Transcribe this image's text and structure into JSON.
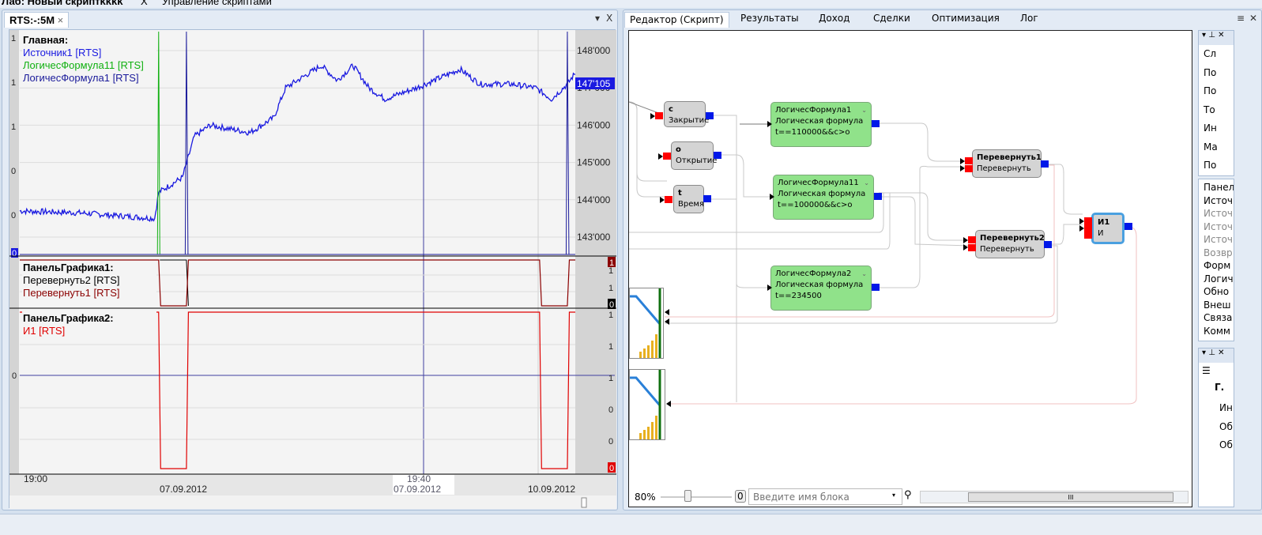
{
  "top_tabs": [
    {
      "label": "Лаб: Новый скриптkkkk",
      "close": "X"
    },
    {
      "label": "Управление скриптами"
    }
  ],
  "chart_window": {
    "tab": "RTS:-:5M",
    "close": "×",
    "menu": "▾",
    "x": "X"
  },
  "chart_data": [
    {
      "type": "line",
      "title": "Главная:",
      "legend": [
        {
          "name": "Источник1 [RTS]",
          "color": "#1a1ae0"
        },
        {
          "name": "ЛогичесФормула11 [RTS]",
          "color": "#10b010"
        },
        {
          "name": "ЛогичесФормула1 [RTS]",
          "color": "#1a1a9a"
        }
      ],
      "right_ticks": [
        "148'000",
        "147'000",
        "146'000",
        "145'000",
        "144'000",
        "143'000"
      ],
      "right_values": [
        148000,
        147000,
        146000,
        145000,
        144000,
        143000
      ],
      "last_price": "147'105",
      "left_ticks": [
        "1",
        "1",
        "1",
        "0",
        "0"
      ],
      "left_bottom": "0",
      "price_keypoints": [
        [
          0,
          143700
        ],
        [
          15,
          143650
        ],
        [
          34,
          143500
        ],
        [
          35,
          144200
        ],
        [
          41,
          144600
        ],
        [
          44,
          145700
        ],
        [
          48,
          146000
        ],
        [
          58,
          145800
        ],
        [
          64,
          146200
        ],
        [
          67,
          147000
        ],
        [
          76,
          147600
        ],
        [
          80,
          147200
        ],
        [
          84,
          147600
        ],
        [
          88,
          147000
        ],
        [
          92,
          146700
        ],
        [
          100,
          147000
        ],
        [
          111,
          147500
        ],
        [
          116,
          147100
        ],
        [
          124,
          147100
        ],
        [
          130,
          147000
        ],
        [
          134,
          146700
        ],
        [
          138,
          147100
        ],
        [
          140,
          147400
        ]
      ],
      "ylim": [
        142950,
        148500
      ],
      "bars": 140,
      "green_spikes": [
        35
      ],
      "blue_spikes": [
        42,
        138
      ]
    },
    {
      "type": "line",
      "title": "ПанельГрафика1:",
      "legend": [
        {
          "name": "Перевернуть2 [RTS]",
          "color": "#000000"
        },
        {
          "name": "Перевернуть1 [RTS]",
          "color": "#8b0000"
        }
      ],
      "right_ticks": [
        "1",
        "1",
        "0"
      ],
      "top_badge": "1",
      "bottom_badge": "0",
      "zero_ranges": [
        [
          35,
          42
        ],
        [
          131,
          138
        ]
      ]
    },
    {
      "type": "line",
      "title": "ПанельГрафика2:",
      "legend": [
        {
          "name": "И1 [RTS]",
          "color": "#e00000"
        }
      ],
      "right_ticks": [
        "1",
        "1",
        "1",
        "0",
        "0"
      ],
      "left_tick": "0",
      "bottom_badge": "0",
      "zero_ranges": [
        [
          35,
          42
        ],
        [
          131,
          138
        ]
      ]
    }
  ],
  "time_axis": {
    "labels": [
      "19:00",
      "07.09.2012",
      "10.09.2012"
    ],
    "cursor_time": "19:40",
    "cursor_date": "07.09.2012"
  },
  "editor": {
    "tabs": [
      "Редактор (Скрипт)",
      "Результаты",
      "Доход",
      "Сделки",
      "Оптимизация",
      "Лог"
    ],
    "blocks": {
      "c": {
        "name": "c",
        "type": "Закрытие"
      },
      "o": {
        "name": "o",
        "type": "Открытие"
      },
      "t": {
        "name": "t",
        "type": "Время"
      },
      "lf1": {
        "name": "ЛогичесФормула1",
        "type": "Логическая формула",
        "formula": "t==110000&&c>o"
      },
      "lf11": {
        "name": "ЛогичесФормула11",
        "type": "Логическая формула",
        "formula": "t==100000&&c>o"
      },
      "lf2": {
        "name": "ЛогичесФормула2",
        "type": "Логическая формула",
        "formula": "t==234500"
      },
      "p1": {
        "name": "Перевернуть1",
        "type": "Перевернуть"
      },
      "p2": {
        "name": "Перевернуть2",
        "type": "Перевернуть"
      },
      "i1": {
        "name": "И1",
        "type": "И"
      }
    },
    "zoom": "80%",
    "zoom_value": 0.35,
    "zoom_btn": "0",
    "search_placeholder": "Введите имя блока",
    "scroll_grip": "III"
  },
  "side_panels": {
    "top_items": [
      "Сл",
      "По",
      "По",
      "То",
      "Ин",
      "Ма",
      "По"
    ],
    "mid_items": [
      "Панел",
      "Источ",
      "Источ",
      "Источ",
      "Источ",
      "Возвр",
      "Форм",
      "Логич",
      "Обно",
      "Внеш",
      "Связа",
      "Комм"
    ],
    "bottom_header": "Г.",
    "bottom_items": [
      "Ин",
      "Об",
      "Об"
    ]
  },
  "colors": {
    "accent": "#1a1ae0",
    "bg_chart": "#f4f4f4",
    "axis": "#d4d4d4"
  }
}
